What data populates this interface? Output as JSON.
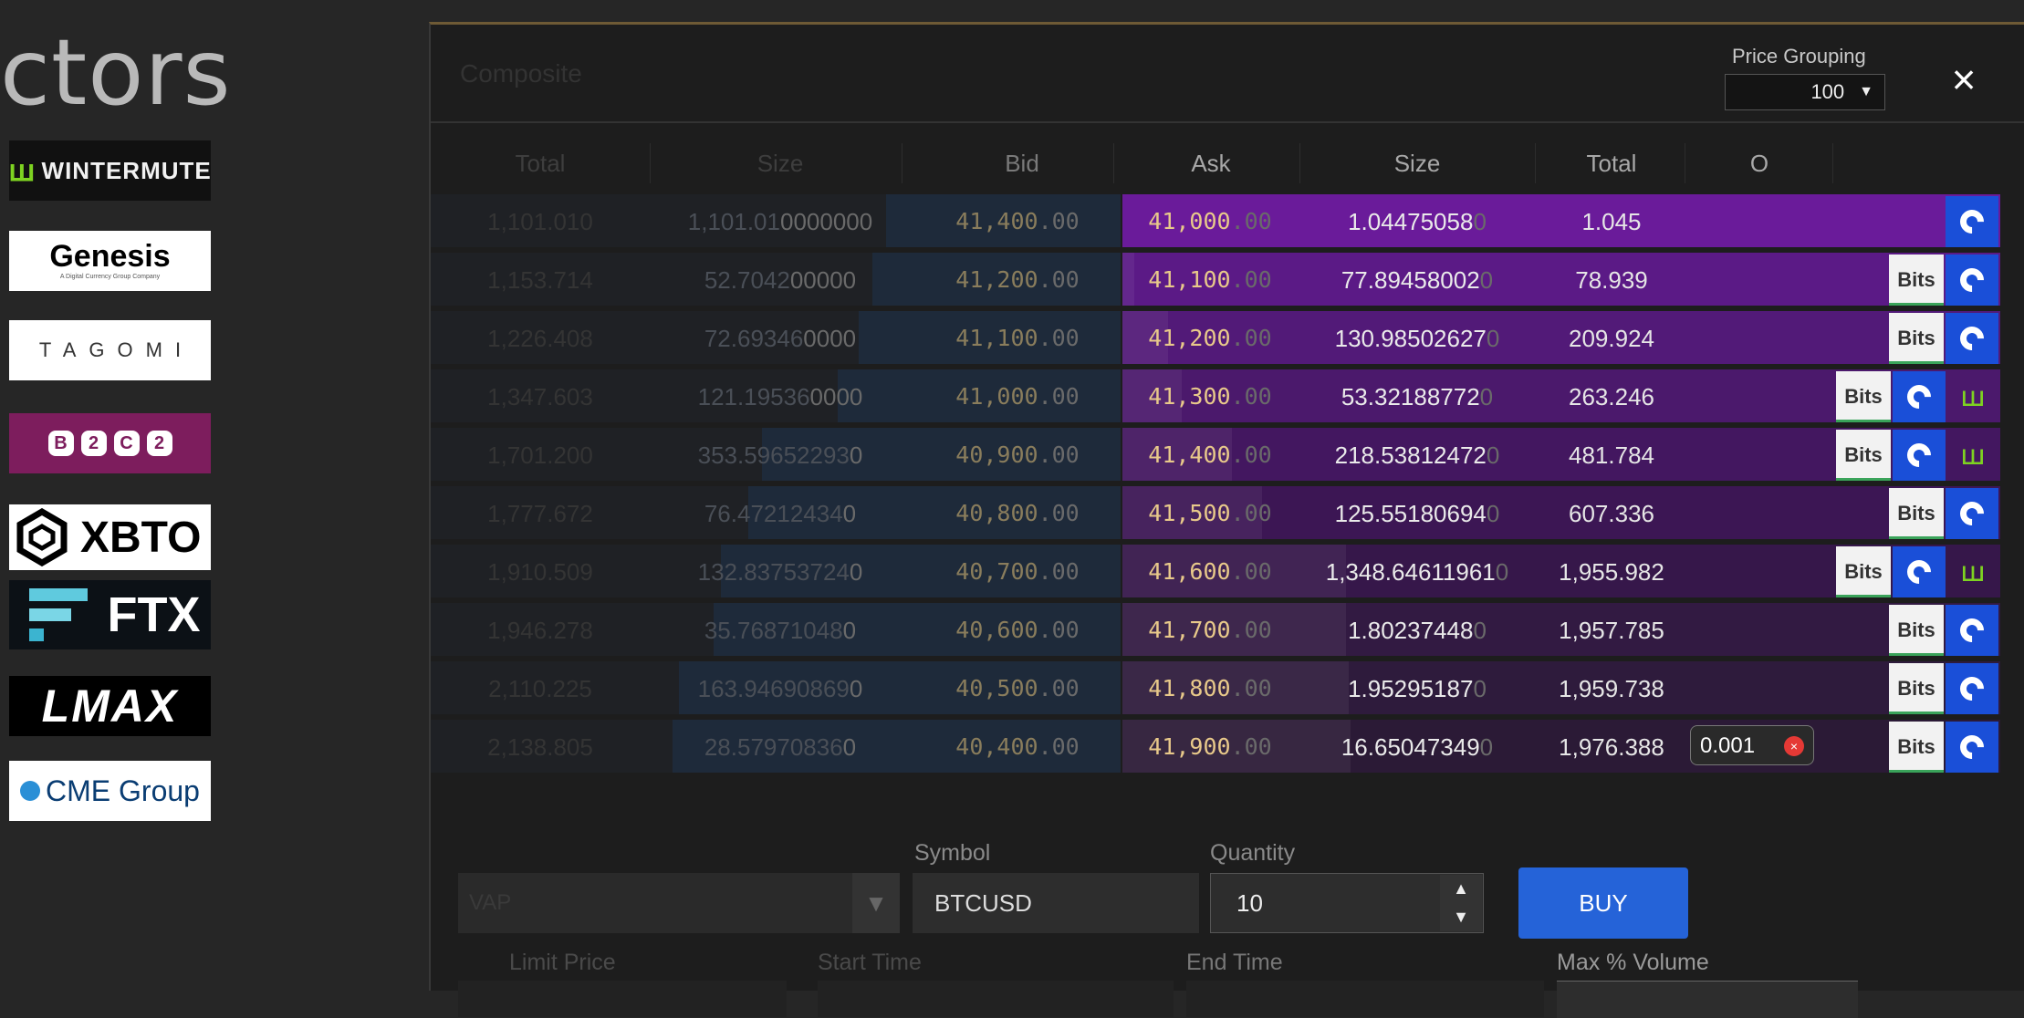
{
  "connectors": {
    "title": "ctors",
    "logos": {
      "wintermute": "WINTERMUTE",
      "genesis": "Genesis",
      "genesis_tagline": "A Digital Currency Group Company",
      "tagomi": "TAGOMI",
      "b2c2": [
        "B",
        "2",
        "C",
        "2"
      ],
      "xbto": "XBTO",
      "ftx": "FTX",
      "lmax": "LMAX",
      "cme": "CME Group"
    }
  },
  "modal": {
    "title": "Composite",
    "price_grouping_label": "Price Grouping",
    "price_grouping_value": "100",
    "close": "×"
  },
  "book": {
    "headers": {
      "bid_total": "Total",
      "bid_size": "Size",
      "bid": "Bid",
      "ask": "Ask",
      "ask_size": "Size",
      "ask_total": "Total",
      "orders": "O"
    },
    "ask_bg_colors": [
      "#6a1b9a",
      "#5b1a86",
      "#521a78",
      "#4b196c",
      "#431760",
      "#3c1654",
      "#36174a",
      "#321a42",
      "#2e1b3c",
      "#2b1a36"
    ],
    "rows": [
      {
        "bid_total": "1,101.010",
        "bid_size": "1,101.01",
        "bid_size_sfx": "0000000",
        "bid": "41,400",
        "bid_sfx": ".00",
        "ask": "41,000",
        "ask_sfx": ".00",
        "ask_size": "1.04475058",
        "ask_size_sfx": "0",
        "ask_total": "1.045",
        "order": "",
        "venues": [
          "coinbase"
        ],
        "bid_depth": 0.34,
        "ask_depth": 0.0
      },
      {
        "bid_total": "1,153.714",
        "bid_size": "52.7042",
        "bid_size_sfx": "00000",
        "bid": "41,200",
        "bid_sfx": ".00",
        "ask": "41,100",
        "ask_sfx": ".00",
        "ask_size": "77.89458002",
        "ask_size_sfx": "0",
        "ask_total": "78.939",
        "order": "",
        "venues": [
          "bitstamp",
          "coinbase"
        ],
        "bid_depth": 0.36,
        "ask_depth": 0.05
      },
      {
        "bid_total": "1,226.408",
        "bid_size": "72.69346",
        "bid_size_sfx": "0000",
        "bid": "41,100",
        "bid_sfx": ".00",
        "ask": "41,200",
        "ask_sfx": ".00",
        "ask_size": "130.98502627",
        "ask_size_sfx": "0",
        "ask_total": "209.924",
        "order": "",
        "venues": [
          "bitstamp",
          "coinbase"
        ],
        "bid_depth": 0.38,
        "ask_depth": 0.2
      },
      {
        "bid_total": "1,347.603",
        "bid_size": "121.19536",
        "bid_size_sfx": "0000",
        "bid": "41,000",
        "bid_sfx": ".00",
        "ask": "41,300",
        "ask_sfx": ".00",
        "ask_size": "53.32188772",
        "ask_size_sfx": "0",
        "ask_total": "263.246",
        "order": "",
        "venues": [
          "bitstamp",
          "coinbase",
          "wintermute"
        ],
        "bid_depth": 0.41,
        "ask_depth": 0.26
      },
      {
        "bid_total": "1,701.200",
        "bid_size": "353.59652293",
        "bid_size_sfx": "0",
        "bid": "40,900",
        "bid_sfx": ".00",
        "ask": "41,400",
        "ask_sfx": ".00",
        "ask_size": "218.53812472",
        "ask_size_sfx": "0",
        "ask_total": "481.784",
        "order": "",
        "venues": [
          "bitstamp",
          "coinbase",
          "wintermute"
        ],
        "bid_depth": 0.52,
        "ask_depth": 0.48
      },
      {
        "bid_total": "1,777.672",
        "bid_size": "76.47212434",
        "bid_size_sfx": "0",
        "bid": "40,800",
        "bid_sfx": ".00",
        "ask": "41,500",
        "ask_sfx": ".00",
        "ask_size": "125.55180694",
        "ask_size_sfx": "0",
        "ask_total": "607.336",
        "order": "",
        "venues": [
          "bitstamp",
          "coinbase"
        ],
        "bid_depth": 0.54,
        "ask_depth": 0.61
      },
      {
        "bid_total": "1,910.509",
        "bid_size": "132.83753724",
        "bid_size_sfx": "0",
        "bid": "40,700",
        "bid_sfx": ".00",
        "ask": "41,600",
        "ask_sfx": ".00",
        "ask_size": "1,348.64611961",
        "ask_size_sfx": "0",
        "ask_total": "1,955.982",
        "order": "",
        "venues": [
          "bitstamp",
          "coinbase",
          "wintermute"
        ],
        "bid_depth": 0.58,
        "ask_depth": 0.98
      },
      {
        "bid_total": "1,946.278",
        "bid_size": "35.76871048",
        "bid_size_sfx": "0",
        "bid": "40,600",
        "bid_sfx": ".00",
        "ask": "41,700",
        "ask_sfx": ".00",
        "ask_size": "1.80237448",
        "ask_size_sfx": "0",
        "ask_total": "1,957.785",
        "order": "",
        "venues": [
          "bitstamp",
          "coinbase"
        ],
        "bid_depth": 0.59,
        "ask_depth": 0.98
      },
      {
        "bid_total": "2,110.225",
        "bid_size": "163.94690869",
        "bid_size_sfx": "0",
        "bid": "40,500",
        "bid_sfx": ".00",
        "ask": "41,800",
        "ask_sfx": ".00",
        "ask_size": "1.95295187",
        "ask_size_sfx": "0",
        "ask_total": "1,959.738",
        "order": "",
        "venues": [
          "bitstamp",
          "coinbase"
        ],
        "bid_depth": 0.64,
        "ask_depth": 0.99
      },
      {
        "bid_total": "2,138.805",
        "bid_size": "28.57970836",
        "bid_size_sfx": "0",
        "bid": "40,400",
        "bid_sfx": ".00",
        "ask": "41,900",
        "ask_sfx": ".00",
        "ask_size": "16.65047349",
        "ask_size_sfx": "0",
        "ask_total": "1,976.388",
        "order": "0.001",
        "venues": [
          "bitstamp",
          "coinbase"
        ],
        "bid_depth": 0.65,
        "ask_depth": 1.0
      }
    ],
    "venue_labels": {
      "bitstamp": "Bits",
      "wintermute": "ꟺ"
    }
  },
  "order_entry": {
    "algo_value": "VAP",
    "algo_arrow": "▼",
    "symbol_label": "Symbol",
    "symbol_value": "BTCUSD",
    "quantity_label": "Quantity",
    "quantity_value": "10",
    "stepper_up": "▲",
    "stepper_down": "▼",
    "buy_label": "BUY",
    "limit_price_label": "Limit Price",
    "start_time_label": "Start Time",
    "end_time_label": "End Time",
    "max_volume_label": "Max % Volume"
  }
}
